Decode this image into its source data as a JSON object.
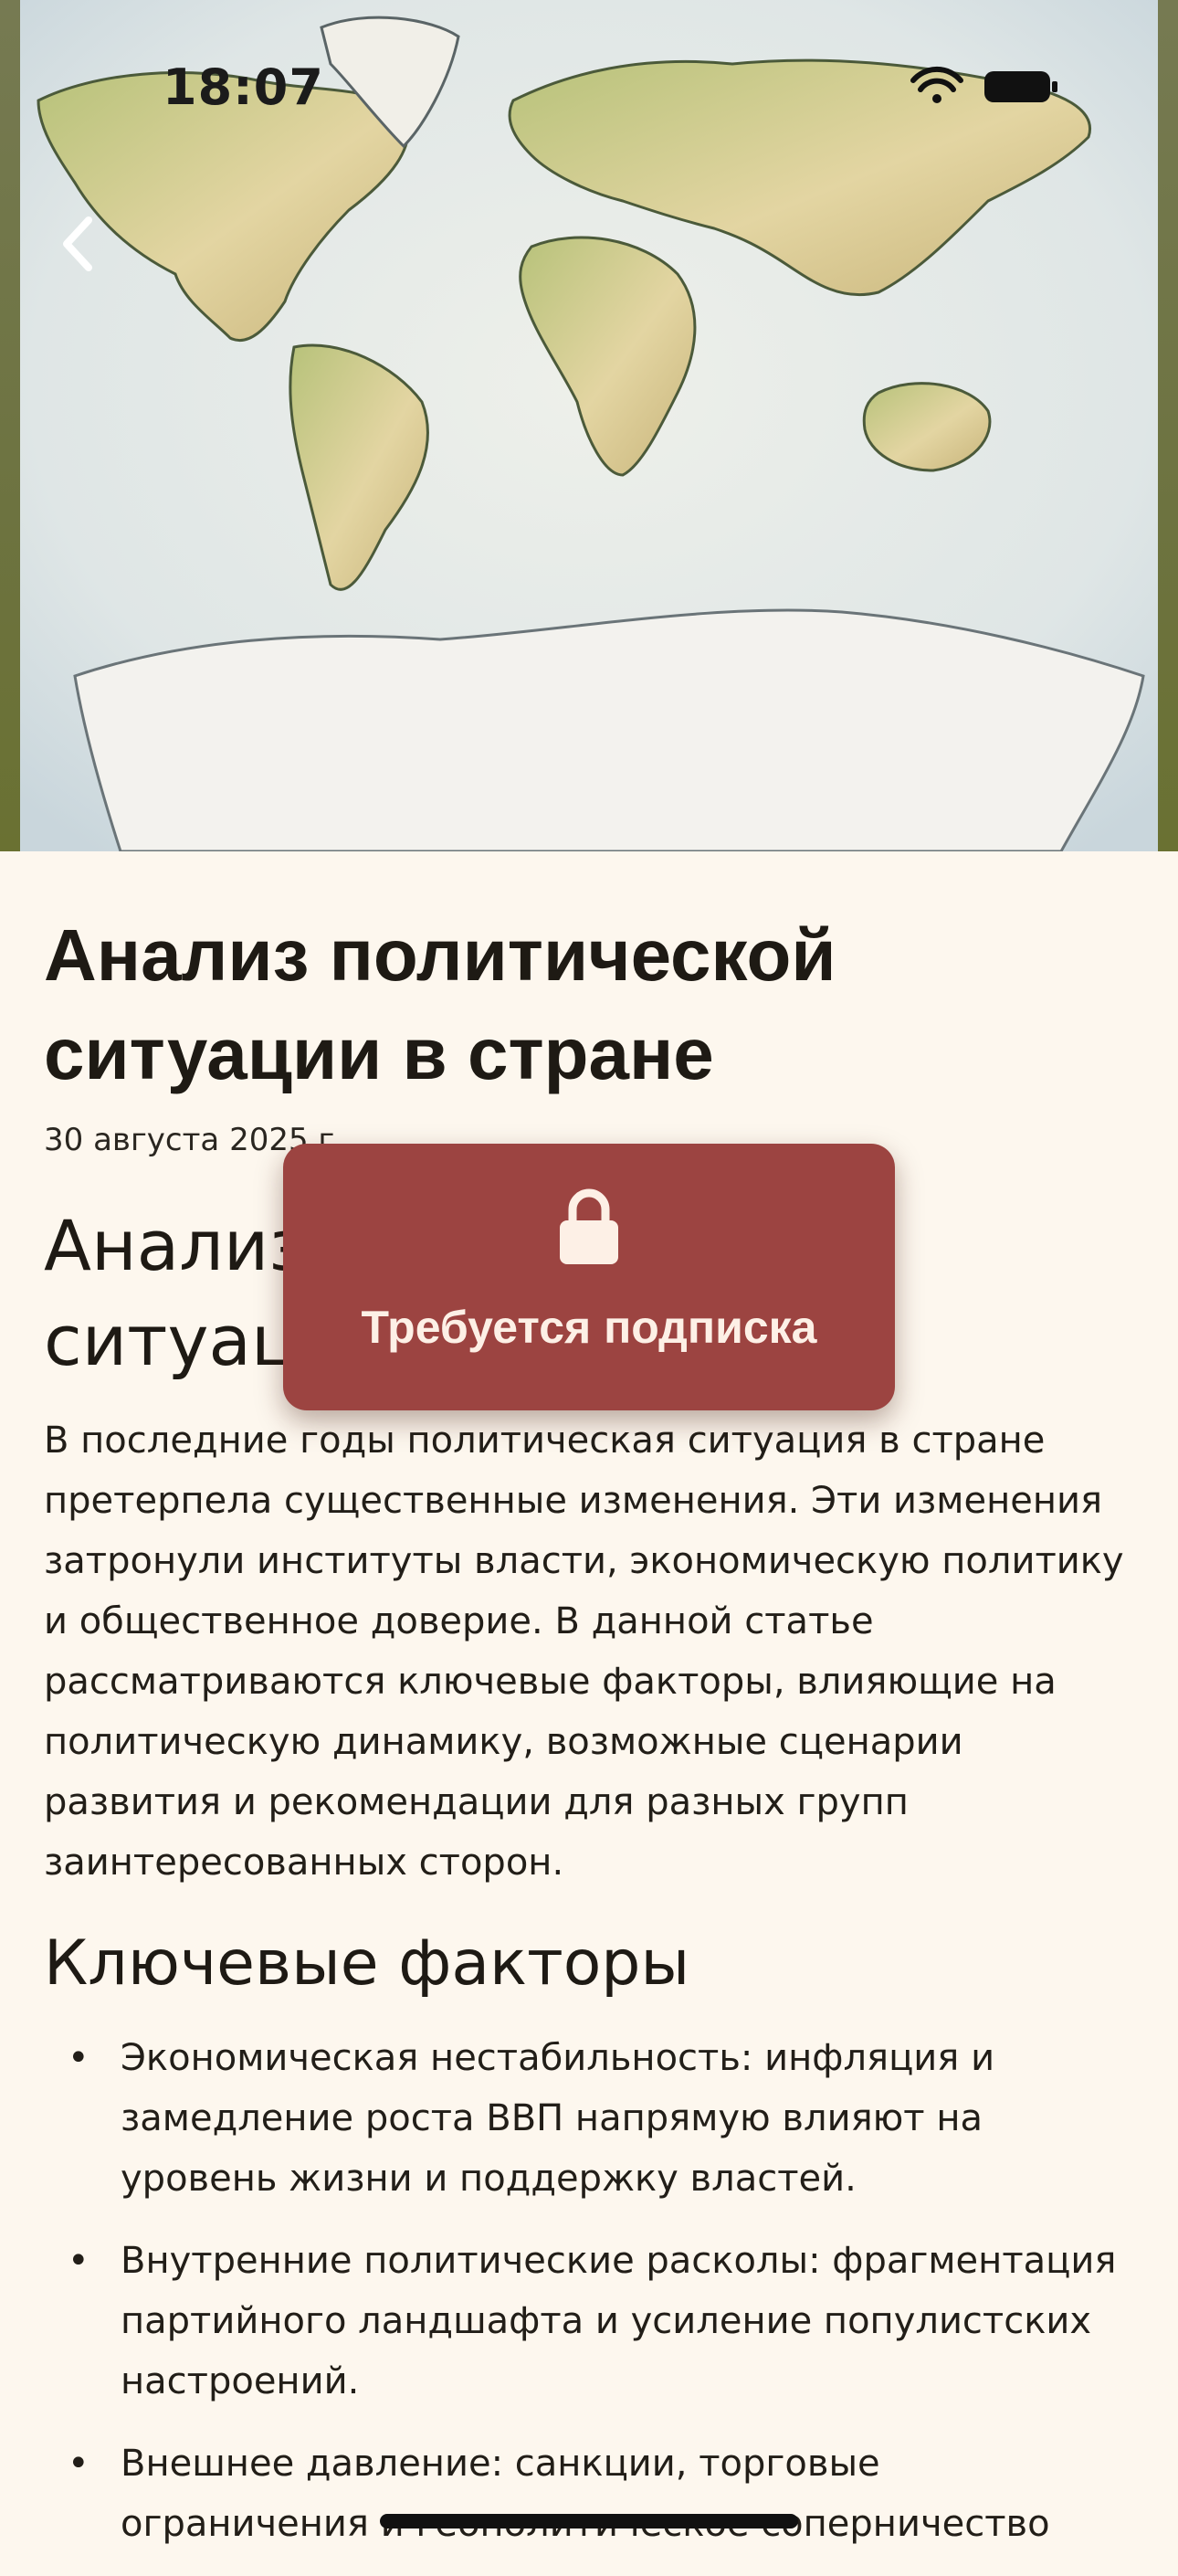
{
  "status_bar": {
    "time": "18:07"
  },
  "hero": {
    "image": "world-map-illustration",
    "back_icon": "chevron-left-icon"
  },
  "article": {
    "title": "Анализ политической ситуации в стране",
    "date": "30 августа 2025 г.",
    "heading": "Анализ политической ситуации в стране",
    "intro": "В последние годы политическая ситуация в стране претерпела существенные изменения. Эти изменения затронули институты власти, экономическую политику и общественное доверие. В данной статье рассматриваются ключевые факторы, влияющие на политическую динамику, возможные сценарии развития и рекомендации для разных групп заинтересованных сторон.",
    "section_heading": "Ключевые факторы",
    "bullets": [
      "Экономическая нестабильность: инфляция и замедление роста ВВП напрямую влияют на уровень жизни и поддержку властей.",
      "Внутренние политические расколы: фрагментация партийного ландшафта и усиление популистских настроений.",
      "Внешнее давление: санкции, торговые ограничения и геополитическое соперничество"
    ],
    "bullet_symbol": "•"
  },
  "paywall": {
    "icon": "lock-icon",
    "label": "Требуется подписка",
    "color": "#9c4441"
  }
}
